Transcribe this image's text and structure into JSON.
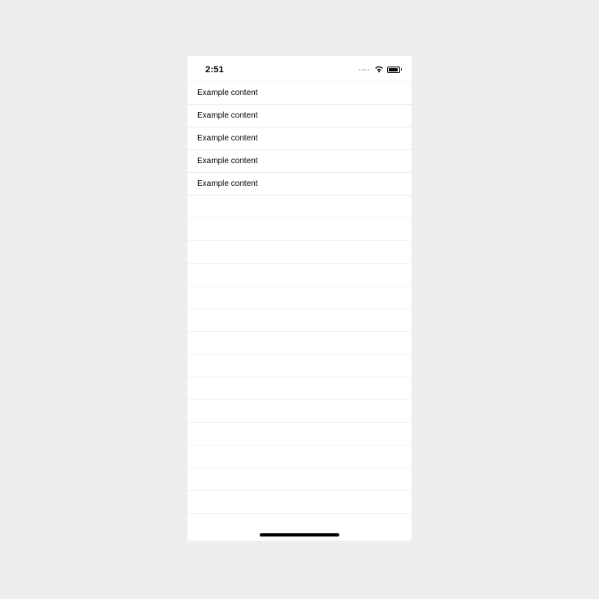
{
  "status_bar": {
    "time": "2:51"
  },
  "rows": [
    {
      "label": "Example content"
    },
    {
      "label": "Example content"
    },
    {
      "label": "Example content"
    },
    {
      "label": "Example content"
    },
    {
      "label": "Example content"
    }
  ]
}
